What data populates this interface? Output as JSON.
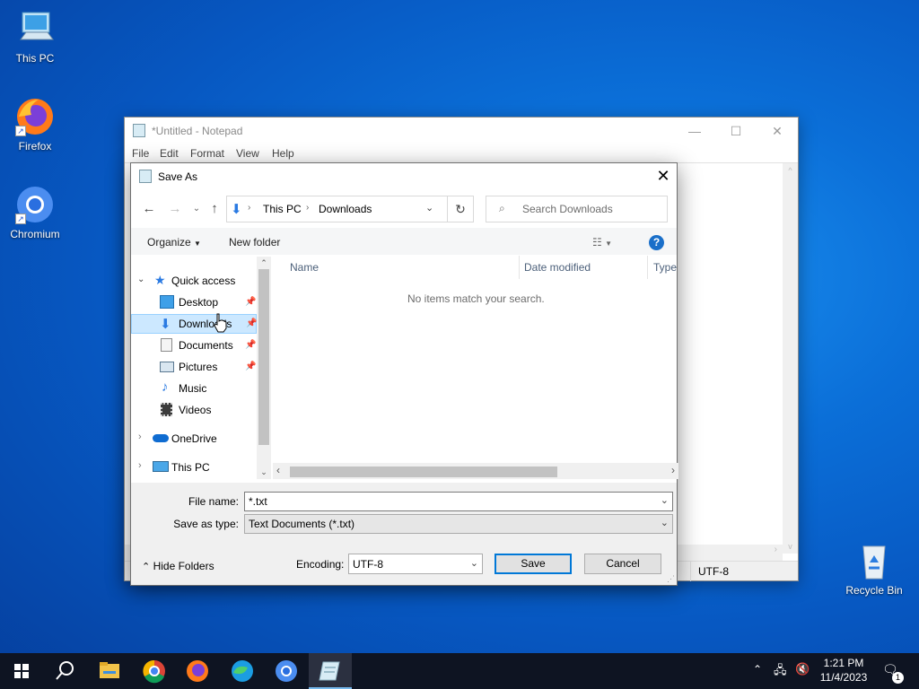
{
  "desktop": {
    "icons": [
      {
        "label": "This PC"
      },
      {
        "label": "Firefox"
      },
      {
        "label": "Chromium"
      },
      {
        "label": "Recycle Bin"
      }
    ]
  },
  "notepad": {
    "title": "*Untitled - Notepad",
    "menu": [
      "File",
      "Edit",
      "Format",
      "View",
      "Help"
    ],
    "status_encoding": "UTF-8"
  },
  "dialog": {
    "title": "Save As",
    "address": {
      "segments": [
        "This PC",
        "Downloads"
      ]
    },
    "search_placeholder": "Search Downloads",
    "toolbar": {
      "organize": "Organize",
      "new_folder": "New folder"
    },
    "nav_tree": [
      {
        "label": "Quick access",
        "icon": "star-icon",
        "pinned": false,
        "expanded": true
      },
      {
        "label": "Desktop",
        "icon": "desktop-folder-icon",
        "pinned": true
      },
      {
        "label": "Downloads",
        "icon": "downloads-folder-icon",
        "pinned": true,
        "selected": true
      },
      {
        "label": "Documents",
        "icon": "documents-folder-icon",
        "pinned": true
      },
      {
        "label": "Pictures",
        "icon": "pictures-folder-icon",
        "pinned": true
      },
      {
        "label": "Music",
        "icon": "music-folder-icon",
        "pinned": false
      },
      {
        "label": "Videos",
        "icon": "videos-folder-icon",
        "pinned": false
      },
      {
        "label": "OneDrive",
        "icon": "onedrive-icon",
        "pinned": false
      },
      {
        "label": "This PC",
        "icon": "this-pc-icon",
        "pinned": false
      }
    ],
    "columns": [
      "Name",
      "Date modified",
      "Type"
    ],
    "empty_message": "No items match your search.",
    "file_name_label": "File name:",
    "file_name_value": "*.txt",
    "save_type_label": "Save as type:",
    "save_type_value": "Text Documents (*.txt)",
    "hide_folders": "Hide Folders",
    "encoding_label": "Encoding:",
    "encoding_value": "UTF-8",
    "save_button": "Save",
    "cancel_button": "Cancel"
  },
  "taskbar": {
    "apps": [
      "start-icon",
      "search-icon",
      "file-explorer-icon",
      "chrome-icon",
      "firefox-icon",
      "edge-icon",
      "chromium-icon",
      "notepad-icon"
    ],
    "time": "1:21 PM",
    "date": "11/4/2023",
    "notification_count": "1"
  },
  "colors": {
    "accent": "#0078d7",
    "taskbar": "#0e1422",
    "selected_row": "#cce8ff"
  }
}
